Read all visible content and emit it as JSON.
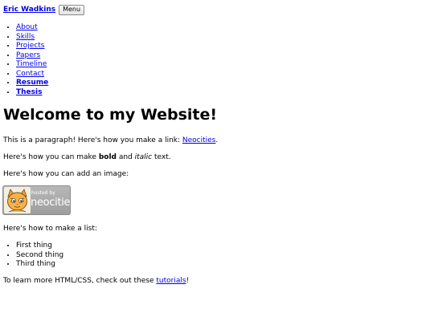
{
  "header": {
    "site_name": "Eric Wadkins",
    "menu_label": "Menu"
  },
  "nav": {
    "items": [
      {
        "label": "About"
      },
      {
        "label": "Skills"
      },
      {
        "label": "Projects"
      },
      {
        "label": "Papers"
      },
      {
        "label": "Timeline"
      },
      {
        "label": "Contact"
      },
      {
        "label": "Resume"
      },
      {
        "label": "Thesis"
      }
    ]
  },
  "main": {
    "title": "Welcome to my Website!",
    "p1_text": "This is a paragraph! Here's how you make a link: ",
    "p1_link": "Neocities",
    "p1_end": ".",
    "p2_start": "Here's how you can make ",
    "p2_bold": "bold",
    "p2_mid": " and ",
    "p2_italic": "italic",
    "p2_end": " text.",
    "p3_text": "Here's how you can add an image:",
    "badge": {
      "small_text": "hosted by",
      "big_text": "neocities",
      "icon": "neocities-cat-icon"
    },
    "p4_text": "Here's how to make a list:",
    "list_items": [
      "First thing",
      "Second thing",
      "Third thing"
    ],
    "p5_text": "To learn more HTML/CSS, check out these ",
    "p5_link": "tutorials",
    "p5_end": "!"
  },
  "colors": {
    "link": "#0000ee",
    "text": "#000000",
    "background": "#ffffff",
    "badge_bg": "#a9a9a9"
  }
}
